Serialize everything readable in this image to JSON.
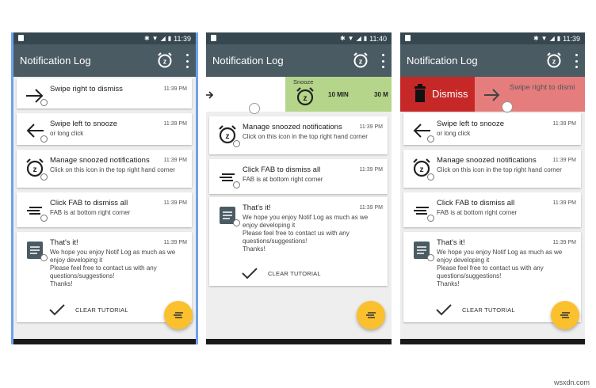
{
  "app_title": "Notification Log",
  "times": {
    "p1": "11:39",
    "p2": "11:40",
    "p3": "11:39"
  },
  "item_time": "11:39 PM",
  "items": {
    "swipe_right": {
      "title": "Swipe right to dismiss"
    },
    "swipe_left": {
      "title": "Swipe left to snooze",
      "body": "or long click"
    },
    "manage": {
      "title": "Manage snoozed notifications",
      "body": "Click on this icon in the top right hand corner"
    },
    "fab": {
      "title": "Click FAB to dismiss all",
      "body": "FAB is at bottom right corner"
    },
    "thats": {
      "title": "That's it!",
      "body": "We hope you enjoy Notif Log as much as we enjoy developing it\nPlease feel free to contact us with any questions/suggestions!\nThanks!"
    }
  },
  "clear_label": "CLEAR TUTORIAL",
  "snooze": {
    "label": "Snooze",
    "opt1": "10 MIN",
    "opt2": "30 M"
  },
  "dismiss": {
    "label": "Dismiss",
    "ghost_title": "Swipe right to dismi"
  },
  "colors": {
    "appbar": "#4a5b63",
    "statusbar": "#37474f",
    "fab": "#fbc02d",
    "snooze": "#b5d58a",
    "dismiss": "#c62828"
  },
  "watermark": "wsxdn.com"
}
